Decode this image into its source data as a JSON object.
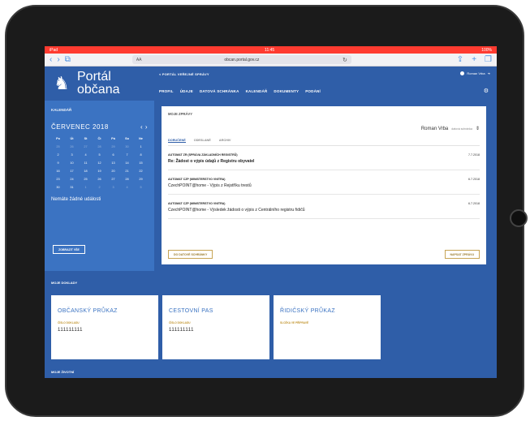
{
  "status": {
    "left": "iPad",
    "time": "11:45",
    "right": "100%"
  },
  "browser": {
    "url": "obcan.portal.gov.cz",
    "aa_label": "AA"
  },
  "site": {
    "logo_line1": "Portál",
    "logo_line2": "občana",
    "breadcrumb": "< PORTÁL VEŘEJNÉ SPRÁVY",
    "user_label": "Roman Vrba",
    "nav": [
      "PROFIL",
      "ÚDAJE",
      "DATOVÁ SCHRÁNKA",
      "KALENDÁŘ",
      "DOKUMENTY",
      "PODÁNÍ"
    ]
  },
  "calendar": {
    "title": "KALENDÁŘ",
    "month": "ČERVENEC 2018",
    "arrows": "‹ ›",
    "weekdays": [
      "Po",
      "Út",
      "St",
      "Čt",
      "Pá",
      "So",
      "Ne"
    ],
    "days": [
      [
        "25",
        "26",
        "27",
        "28",
        "29",
        "30",
        "1"
      ],
      [
        "2",
        "3",
        "4",
        "5",
        "6",
        "7",
        "8"
      ],
      [
        "9",
        "10",
        "11",
        "12",
        "13",
        "14",
        "15"
      ],
      [
        "16",
        "17",
        "18",
        "19",
        "20",
        "21",
        "22"
      ],
      [
        "23",
        "24",
        "25",
        "26",
        "27",
        "28",
        "29"
      ],
      [
        "30",
        "31",
        "1",
        "2",
        "3",
        "4",
        "5"
      ]
    ],
    "no_events": "Nemáte žádné události",
    "button": "ZOBRAZIT VŠE"
  },
  "messages": {
    "title": "MOJE ZPRÁVY",
    "user": "Roman Vrba",
    "user_meta": "datová schránka",
    "tabs": [
      "DORUČENÉ",
      "ODESLANÉ",
      "ARCHIV"
    ],
    "items": [
      {
        "from": "AUTOMAT ZR (SPRÁVA ZÁKLADNÍCH REGISTRŮ)",
        "subject": "Re: Žádost o výpis údajů z Registru obyvatel",
        "date": "7.7.2018",
        "bold": true
      },
      {
        "from": "AUTOMAT CZP (MINISTERSTVO VNITRA)",
        "subject": "CzechPOINT@home - Výpis z Rejstříku trestů",
        "date": "6.7.2018",
        "bold": false
      },
      {
        "from": "AUTOMAT CZP (MINISTERSTVO VNITRA)",
        "subject": "CzechPOINT@home - Výsledek žádosti o výpis z Centrálního registru řidičů",
        "date": "6.7.2018",
        "bold": false
      }
    ],
    "btn_left": "DO DATOVÉ SCHRÁNKY",
    "btn_right": "NAPSAT ZPRÁVU"
  },
  "documents": {
    "title": "MOJE DOKLADY",
    "items": [
      {
        "name": "OBČANSKÝ PRŮKAZ",
        "label": "ČÍSLO DOKLADU",
        "number": "111111111"
      },
      {
        "name": "CESTOVNÍ PAS",
        "label": "ČÍSLO DOKLADU",
        "number": "111111111"
      },
      {
        "name": "ŘIDIČSKÝ PRŮKAZ",
        "label": "SLOŽKA VE PŘÍPRAVĚ",
        "number": ""
      }
    ]
  },
  "bottom_title": "MOJE ŽIVOTNÍ"
}
